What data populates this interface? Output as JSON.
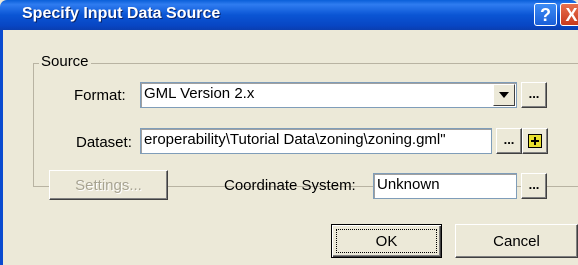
{
  "window": {
    "title": "Specify Input Data Source",
    "help_label": "?",
    "close_label": "X"
  },
  "source": {
    "group_label": "Source",
    "format": {
      "label": "Format:",
      "value": "GML Version 2.x",
      "browse_label": "..."
    },
    "dataset": {
      "label": "Dataset:",
      "value": "eroperability\\Tutorial Data\\zoning\\zoning.gml\"",
      "browse_label": "...",
      "add_icon": "plus-icon"
    },
    "settings_label": "Settings...",
    "coordinate_system": {
      "label": "Coordinate System:",
      "value": "Unknown",
      "browse_label": "..."
    }
  },
  "buttons": {
    "ok_label": "OK",
    "cancel_label": "Cancel"
  },
  "colors": {
    "titlebar": "#0a55d4",
    "dialog_bg": "#ece9d8",
    "input_border": "#7f9db9"
  }
}
